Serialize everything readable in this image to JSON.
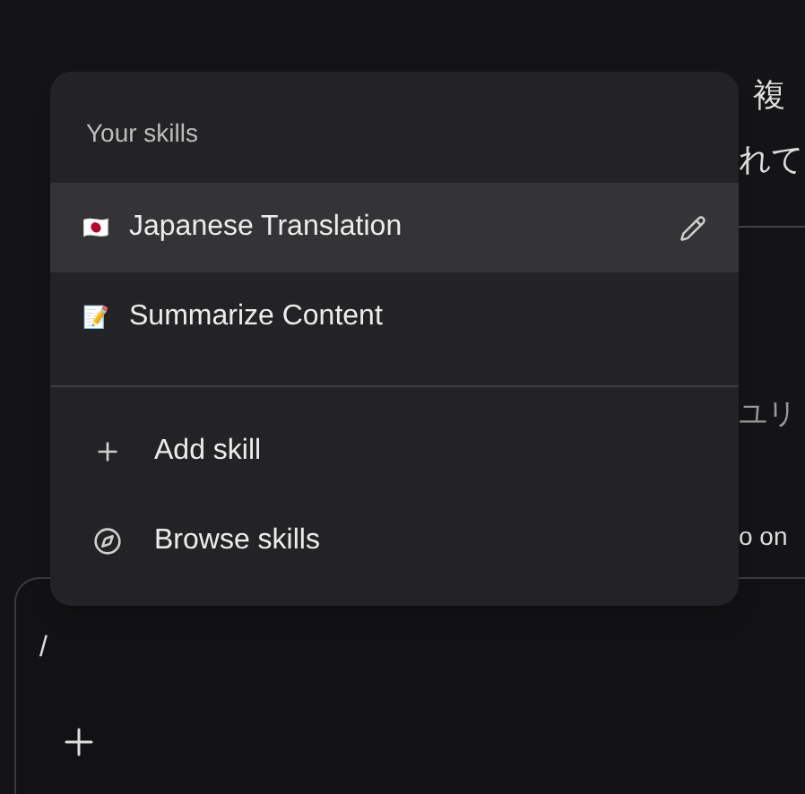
{
  "background": {
    "fragments": [
      "複",
      "れて",
      "ユリ",
      "o on"
    ]
  },
  "composer": {
    "value": "/"
  },
  "menu": {
    "heading": "Your skills",
    "skills": [
      {
        "emoji": "🇯🇵",
        "label": "Japanese Translation",
        "selected": true
      },
      {
        "emoji": "📝",
        "label": "Summarize Content",
        "selected": false
      }
    ],
    "actions": [
      {
        "kind": "add",
        "label": "Add skill"
      },
      {
        "kind": "browse",
        "label": "Browse skills"
      }
    ]
  }
}
